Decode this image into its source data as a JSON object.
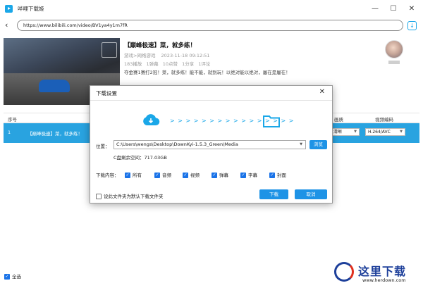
{
  "app": {
    "title": "哔哩下载姬"
  },
  "window_controls": {
    "minimize": "—",
    "maximize": "☐",
    "close": "✕"
  },
  "address": {
    "url": "https://www.bilibili.com/video/BV1ya4y1m7fR",
    "back_icon": "‹"
  },
  "video": {
    "title": "【巅峰极速】菜，就多练！",
    "category": "游戏>网络游戏",
    "date": "2023-11-18 09:12:51",
    "stats": [
      "183播放",
      "1弹幕",
      "10点赞",
      "1分享",
      "1评论"
    ],
    "description": "夺金赛1赛打2冠！菜，就多练！能不能，就别玩！以绝对能以绝对，屡在是屡在！"
  },
  "table": {
    "headers": {
      "index": "序号",
      "quality": "画质",
      "codec": "视频编码"
    },
    "rows": [
      {
        "index": "1",
        "title": "【巅峰极速】菜，就多练！",
        "quality": "清晰",
        "codec": "H.264/AVC"
      }
    ]
  },
  "bottom": {
    "select_all": "全选"
  },
  "dialog": {
    "title": "下载设置",
    "close": "✕",
    "arrows": "> > > > > > > > > > > > > > > >",
    "location_label": "位置：",
    "location_value": "C:\\Users\\wengs\\Desktop\\DownKyi-1.5.3_Green\\Media",
    "browse_label": "浏览",
    "disk_space": "C盘剩余空间：717.03GB",
    "content_label": "下载内容：",
    "options": [
      "所有",
      "音频",
      "视频",
      "弹幕",
      "字幕",
      "封面"
    ],
    "default_dir_label": "设此文件夹为默认下载文件夹",
    "download_label": "下载",
    "cancel_label": "取消"
  },
  "watermark": {
    "text": "这里下载",
    "url": "www.herdown.com"
  },
  "colors": {
    "accent": "#1e93e6",
    "row_selected": "#29a3e0",
    "icon_blue": "#1aa7e8"
  }
}
